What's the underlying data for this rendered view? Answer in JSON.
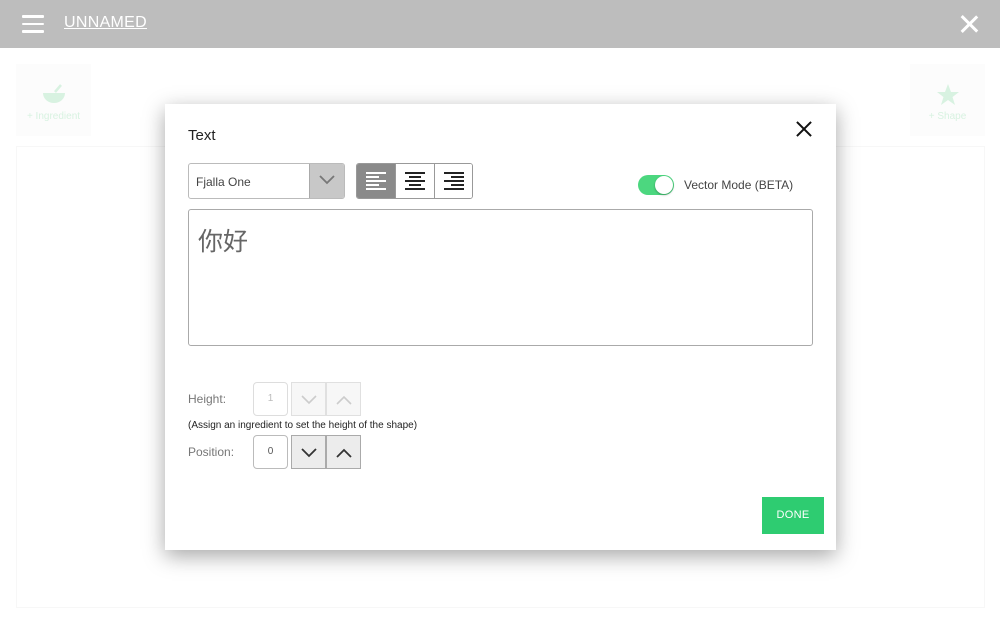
{
  "header": {
    "title": "UNNAMED"
  },
  "toolbar": {
    "ingredient_label": "+ Ingredient",
    "shape_label": "+ Shape"
  },
  "dialog": {
    "title": "Text",
    "font_value": "Fjalla One",
    "vector_mode_label": "Vector Mode (BETA)",
    "vector_mode_on": true,
    "text_value": "你好",
    "height_label": "Height:",
    "height_value": "1",
    "height_hint": "(Assign an ingredient to set the height of the shape)",
    "position_label": "Position:",
    "position_value": "0",
    "done_label": "DONE"
  },
  "colors": {
    "accent": "#2ecc71",
    "toggle": "#4cd77f",
    "topbar": "#bdbdbd"
  },
  "icons": [
    "menu-icon",
    "close-icon",
    "bowl-icon",
    "star-icon",
    "chevron-down-icon",
    "align-left-icon",
    "align-center-icon",
    "align-right-icon",
    "chevron-up-icon"
  ]
}
